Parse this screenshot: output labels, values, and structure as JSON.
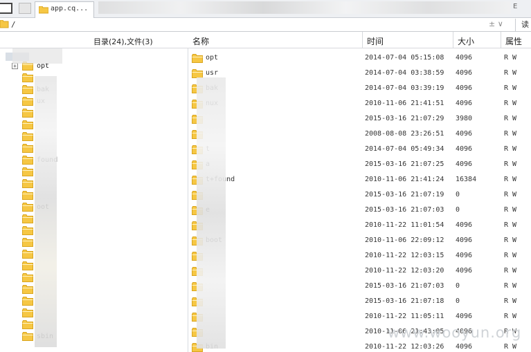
{
  "tabs": {
    "active_label": "app.cq...",
    "right_label": "E"
  },
  "path": {
    "value": "/",
    "controls": "± ∨",
    "read_label": "读"
  },
  "tree": {
    "summary": "目录(24),文件(3)",
    "items": [
      {
        "label": "opt",
        "expander": "+"
      },
      {
        "label": "",
        "expander": ""
      },
      {
        "label": "bak",
        "expander": ""
      },
      {
        "label": "ux",
        "expander": ""
      },
      {
        "label": "",
        "expander": ""
      },
      {
        "label": "",
        "expander": ""
      },
      {
        "label": "",
        "expander": ""
      },
      {
        "label": "",
        "expander": ""
      },
      {
        "label": "found",
        "expander": ""
      },
      {
        "label": "",
        "expander": ""
      },
      {
        "label": "",
        "expander": ""
      },
      {
        "label": "",
        "expander": ""
      },
      {
        "label": "oot",
        "expander": ""
      },
      {
        "label": "",
        "expander": ""
      },
      {
        "label": "",
        "expander": ""
      },
      {
        "label": "",
        "expander": ""
      },
      {
        "label": "",
        "expander": ""
      },
      {
        "label": "",
        "expander": ""
      },
      {
        "label": "",
        "expander": ""
      },
      {
        "label": "",
        "expander": ""
      },
      {
        "label": "",
        "expander": ""
      },
      {
        "label": "",
        "expander": ""
      },
      {
        "label": "",
        "expander": ""
      },
      {
        "label": "sbin",
        "expander": ""
      }
    ]
  },
  "columns": {
    "name": "名称",
    "time": "时间",
    "size": "大小",
    "attr": "属性"
  },
  "files": [
    {
      "name": "opt",
      "time": "2014-07-04 05:15:08",
      "size": "4096",
      "attr": "R W"
    },
    {
      "name": "usr",
      "time": "2014-07-04 03:38:59",
      "size": "4096",
      "attr": "R W"
    },
    {
      "name": "bak",
      "time": "2014-07-04 03:39:19",
      "size": "4096",
      "attr": "R W"
    },
    {
      "name": "nux",
      "time": "2010-11-06 21:41:51",
      "size": "4096",
      "attr": "R W"
    },
    {
      "name": "",
      "time": "2015-03-16 21:07:29",
      "size": "3980",
      "attr": "R W"
    },
    {
      "name": "",
      "time": "2008-08-08 23:26:51",
      "size": "4096",
      "attr": "R W"
    },
    {
      "name": "t",
      "time": "2014-07-04 05:49:34",
      "size": "4096",
      "attr": "R W"
    },
    {
      "name": "a",
      "time": "2015-03-16 21:07:25",
      "size": "4096",
      "attr": "R W"
    },
    {
      "name": "t+found",
      "time": "2010-11-06 21:41:24",
      "size": "16384",
      "attr": "R W"
    },
    {
      "name": "",
      "time": "2015-03-16 21:07:19",
      "size": "0",
      "attr": "R W"
    },
    {
      "name": "e",
      "time": "2015-03-16 21:07:03",
      "size": "0",
      "attr": "R W"
    },
    {
      "name": "",
      "time": "2010-11-22 11:01:54",
      "size": "4096",
      "attr": "R W"
    },
    {
      "name": "boot",
      "time": "2010-11-06 22:09:12",
      "size": "4096",
      "attr": "R W"
    },
    {
      "name": "",
      "time": "2010-11-22 12:03:15",
      "size": "4096",
      "attr": "R W"
    },
    {
      "name": "",
      "time": "2010-11-22 12:03:20",
      "size": "4096",
      "attr": "R W"
    },
    {
      "name": "",
      "time": "2015-03-16 21:07:03",
      "size": "0",
      "attr": "R W"
    },
    {
      "name": "",
      "time": "2015-03-16 21:07:18",
      "size": "0",
      "attr": "R W"
    },
    {
      "name": "",
      "time": "2010-11-22 11:05:11",
      "size": "4096",
      "attr": "R W"
    },
    {
      "name": "",
      "time": "2010-11-06 21:43:05",
      "size": "4096",
      "attr": "R W"
    },
    {
      "name": "bin",
      "time": "2010-11-22 12:03:26",
      "size": "4096",
      "attr": "R W"
    }
  ],
  "watermark": "www.wooyun.org",
  "colors": {
    "folder": "#f6c744",
    "folder_dark": "#d9a51f"
  }
}
